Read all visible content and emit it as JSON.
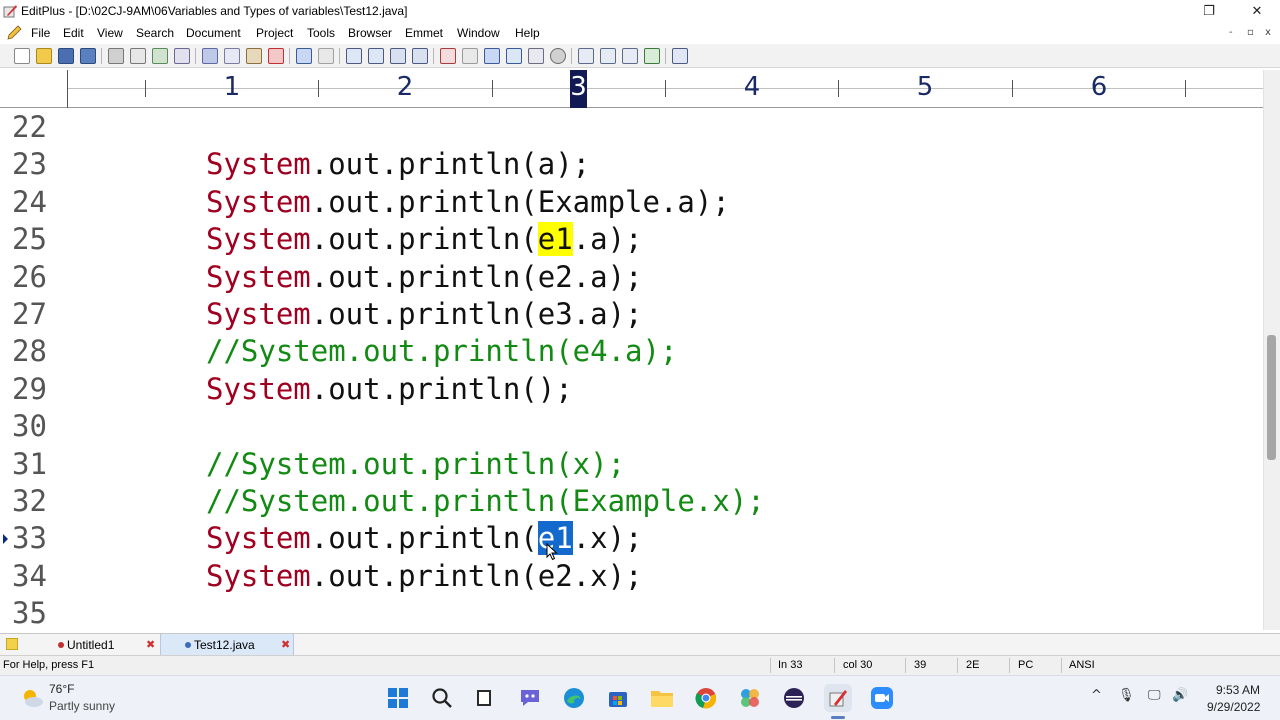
{
  "window": {
    "title": "EditPlus - [D:\\02CJ-9AM\\06Variables and Types of variables\\Test12.java]",
    "controls": {
      "restore": "❐",
      "close": "✕"
    }
  },
  "menu": {
    "items": [
      "File",
      "Edit",
      "View",
      "Search",
      "Document",
      "Project",
      "Tools",
      "Browser",
      "Emmet",
      "Window",
      "Help"
    ],
    "mdi_controls": [
      "-",
      "▫",
      "x"
    ]
  },
  "ruler": {
    "numbers": [
      "1",
      "2",
      "3",
      "4",
      "5",
      "6"
    ],
    "current_column_marker": "3"
  },
  "editor": {
    "lines": [
      {
        "num": "22",
        "kind": "blank",
        "parts": []
      },
      {
        "num": "23",
        "kind": "code",
        "parts": [
          {
            "text": "System",
            "style": "kw"
          },
          {
            "text": ".out.println(a);",
            "style": ""
          }
        ]
      },
      {
        "num": "24",
        "kind": "code",
        "parts": [
          {
            "text": "System",
            "style": "kw"
          },
          {
            "text": ".out.println(Example.a);",
            "style": ""
          }
        ]
      },
      {
        "num": "25",
        "kind": "code",
        "parts": [
          {
            "text": "System",
            "style": "kw"
          },
          {
            "text": ".out.println(",
            "style": ""
          },
          {
            "text": "e1",
            "style": "hl-yellow"
          },
          {
            "text": ".a);",
            "style": ""
          }
        ]
      },
      {
        "num": "26",
        "kind": "code",
        "parts": [
          {
            "text": "System",
            "style": "kw"
          },
          {
            "text": ".out.println(e2.a);",
            "style": ""
          }
        ]
      },
      {
        "num": "27",
        "kind": "code",
        "parts": [
          {
            "text": "System",
            "style": "kw"
          },
          {
            "text": ".out.println(e3.a);",
            "style": ""
          }
        ]
      },
      {
        "num": "28",
        "kind": "comment",
        "parts": [
          {
            "text": "//System.out.println(e4.a);",
            "style": "cm"
          }
        ]
      },
      {
        "num": "29",
        "kind": "code",
        "parts": [
          {
            "text": "System",
            "style": "kw"
          },
          {
            "text": ".out.println();",
            "style": ""
          }
        ]
      },
      {
        "num": "30",
        "kind": "blank",
        "parts": []
      },
      {
        "num": "31",
        "kind": "comment",
        "parts": [
          {
            "text": "//System.out.println(x);",
            "style": "cm"
          }
        ]
      },
      {
        "num": "32",
        "kind": "comment",
        "parts": [
          {
            "text": "//System.out.println(Example.x);",
            "style": "cm"
          }
        ]
      },
      {
        "num": "33",
        "kind": "code",
        "current": true,
        "parts": [
          {
            "text": "System",
            "style": "kw"
          },
          {
            "text": ".out.println(",
            "style": ""
          },
          {
            "text": "e1",
            "style": "hl-sel"
          },
          {
            "text": ".x);",
            "style": ""
          }
        ]
      },
      {
        "num": "34",
        "kind": "code",
        "parts": [
          {
            "text": "System",
            "style": "kw"
          },
          {
            "text": ".out.println(e2.x);",
            "style": ""
          }
        ]
      },
      {
        "num": "35",
        "kind": "blank",
        "parts": []
      }
    ],
    "colors": {
      "keyword": "#a00020",
      "comment": "#138a13",
      "find_highlight": "#ffff00",
      "selection": "#1469cc"
    }
  },
  "tabs": [
    {
      "label": "Untitled1",
      "active": false
    },
    {
      "label": "Test12.java",
      "active": true
    }
  ],
  "status": {
    "help": "For Help, press F1",
    "line": "In 33",
    "col": "col 30",
    "val1": "39",
    "val2": "2E",
    "eol": "PC",
    "encoding": "ANSI"
  },
  "taskbar": {
    "weather": {
      "temp": "76°F",
      "desc": "Partly sunny"
    },
    "apps": [
      "start",
      "search",
      "file-manager",
      "teams",
      "edge",
      "store",
      "file-explorer",
      "chrome",
      "photos",
      "eclipse",
      "editplus",
      "zoom"
    ],
    "tray": {
      "chevron": "^",
      "mic": "🎙",
      "display": "🖵",
      "volume": "🔊"
    },
    "clock": {
      "time": "9:53 AM",
      "date": "9/29/2022"
    }
  }
}
